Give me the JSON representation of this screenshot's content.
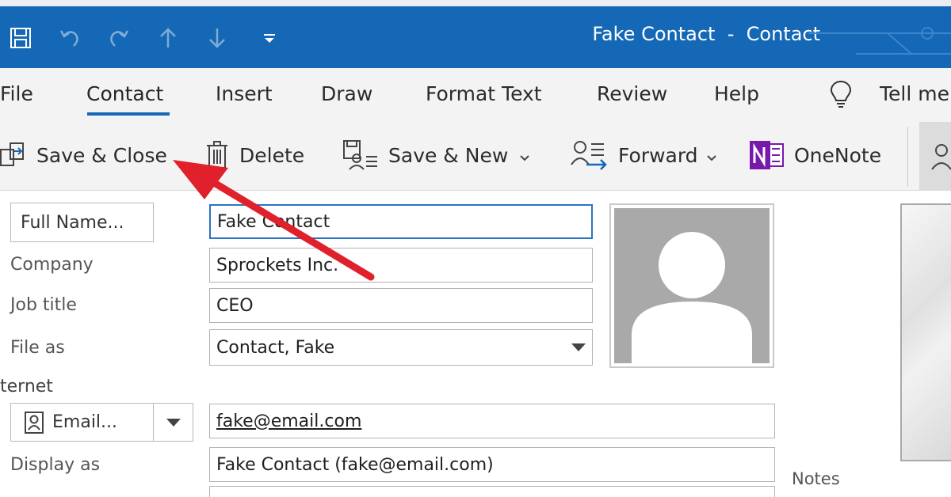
{
  "window": {
    "title": "Fake Contact  -  Contact"
  },
  "quick_access": {
    "icons": [
      "save-icon",
      "undo-icon",
      "redo-icon",
      "arrow-up-icon",
      "arrow-down-icon",
      "customize-dropdown-icon"
    ]
  },
  "tabs": [
    {
      "label": "File"
    },
    {
      "label": "Contact",
      "active": true
    },
    {
      "label": "Insert"
    },
    {
      "label": "Draw"
    },
    {
      "label": "Format Text"
    },
    {
      "label": "Review"
    },
    {
      "label": "Help"
    },
    {
      "label": "Tell me"
    }
  ],
  "ribbon": {
    "save_close": "Save & Close",
    "delete": "Delete",
    "save_new": "Save & New",
    "forward": "Forward",
    "onenote": "OneNote"
  },
  "form": {
    "full_name_button": "Full Name...",
    "full_name_value": "Fake Contact",
    "company_label": "Company",
    "company_value": "Sprockets Inc.",
    "job_title_label": "Job title",
    "job_title_value": "CEO",
    "file_as_label": "File as",
    "file_as_value": "Contact, Fake",
    "internet_label": "ternet",
    "email_button": "Email...",
    "email_value": "fake@email.com",
    "display_as_label": "Display as",
    "display_as_value": "Fake Contact (fake@email.com)",
    "notes_label": "Notes"
  },
  "colors": {
    "title_bar": "#1468b5",
    "accent": "#1468b5",
    "annotation_arrow": "#e0202a",
    "onenote": "#7719aa"
  }
}
